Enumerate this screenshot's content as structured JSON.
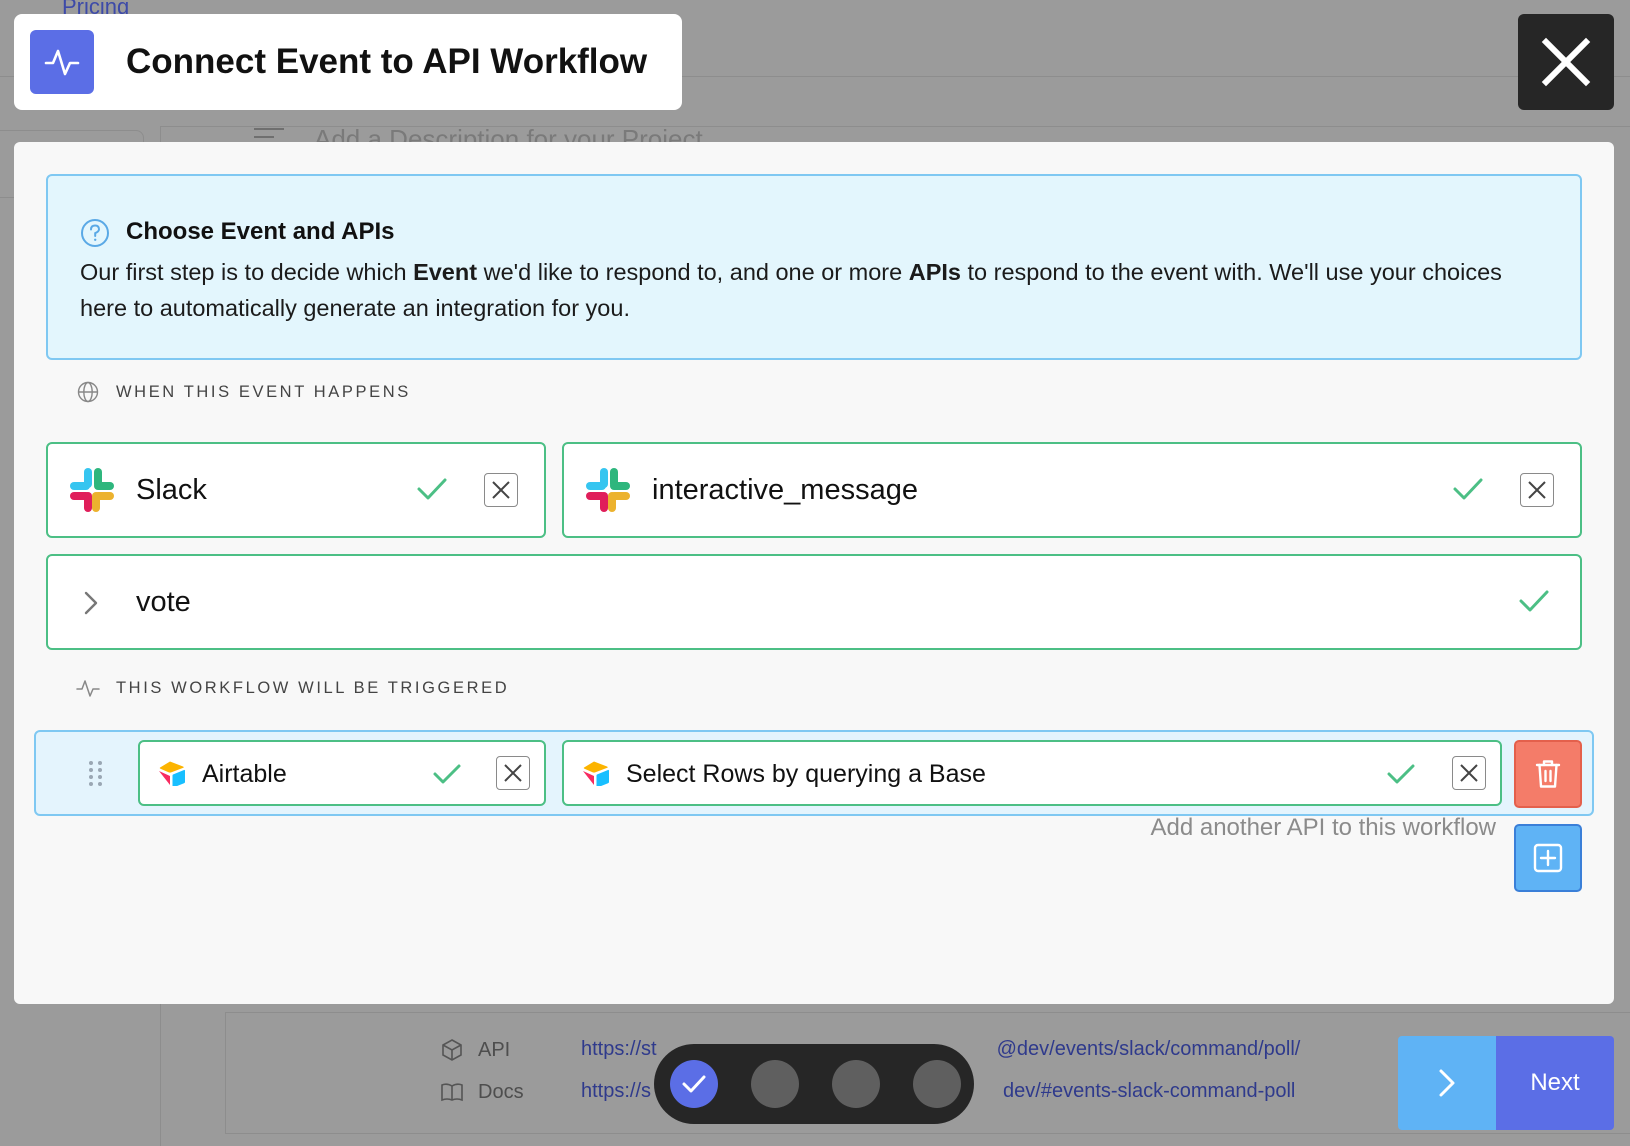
{
  "background": {
    "nav_link": "Pricing",
    "description_placeholder": "Add a Description for your Project",
    "api_label": "API",
    "api_link": "https://st",
    "api_link_tail": "@dev/events/slack/command/poll/",
    "docs_label": "Docs",
    "docs_link": "https://s",
    "docs_link_tail": "dev/#events-slack-command-poll"
  },
  "header": {
    "title": "Connect Event to API Workflow"
  },
  "info": {
    "title": "Choose Event and APIs",
    "body_1": "Our first step is to decide which ",
    "body_event": "Event",
    "body_2": " we'd like to respond to, and one or more ",
    "body_apis": "APIs",
    "body_3": " to respond to the event with. We'll use your choices here to automatically generate an integration for you."
  },
  "event_section": {
    "label": "WHEN THIS EVENT HAPPENS",
    "app": "Slack",
    "event": "interactive_message",
    "sub_event": "vote"
  },
  "workflow_section": {
    "label": "THIS WORKFLOW WILL BE TRIGGERED",
    "api_app": "Airtable",
    "api_action": "Select Rows by querying a Base",
    "add_text": "Add another API to this workflow"
  },
  "stepper": {
    "steps": 4,
    "current": 1
  },
  "footer": {
    "next_label": "Next"
  },
  "colors": {
    "accent": "#5b6ee6",
    "success": "#4cbf85",
    "info_bg": "#e3f6fd",
    "info_border": "#7fc8f2",
    "danger": "#f47c69",
    "add": "#5fb3f5"
  }
}
